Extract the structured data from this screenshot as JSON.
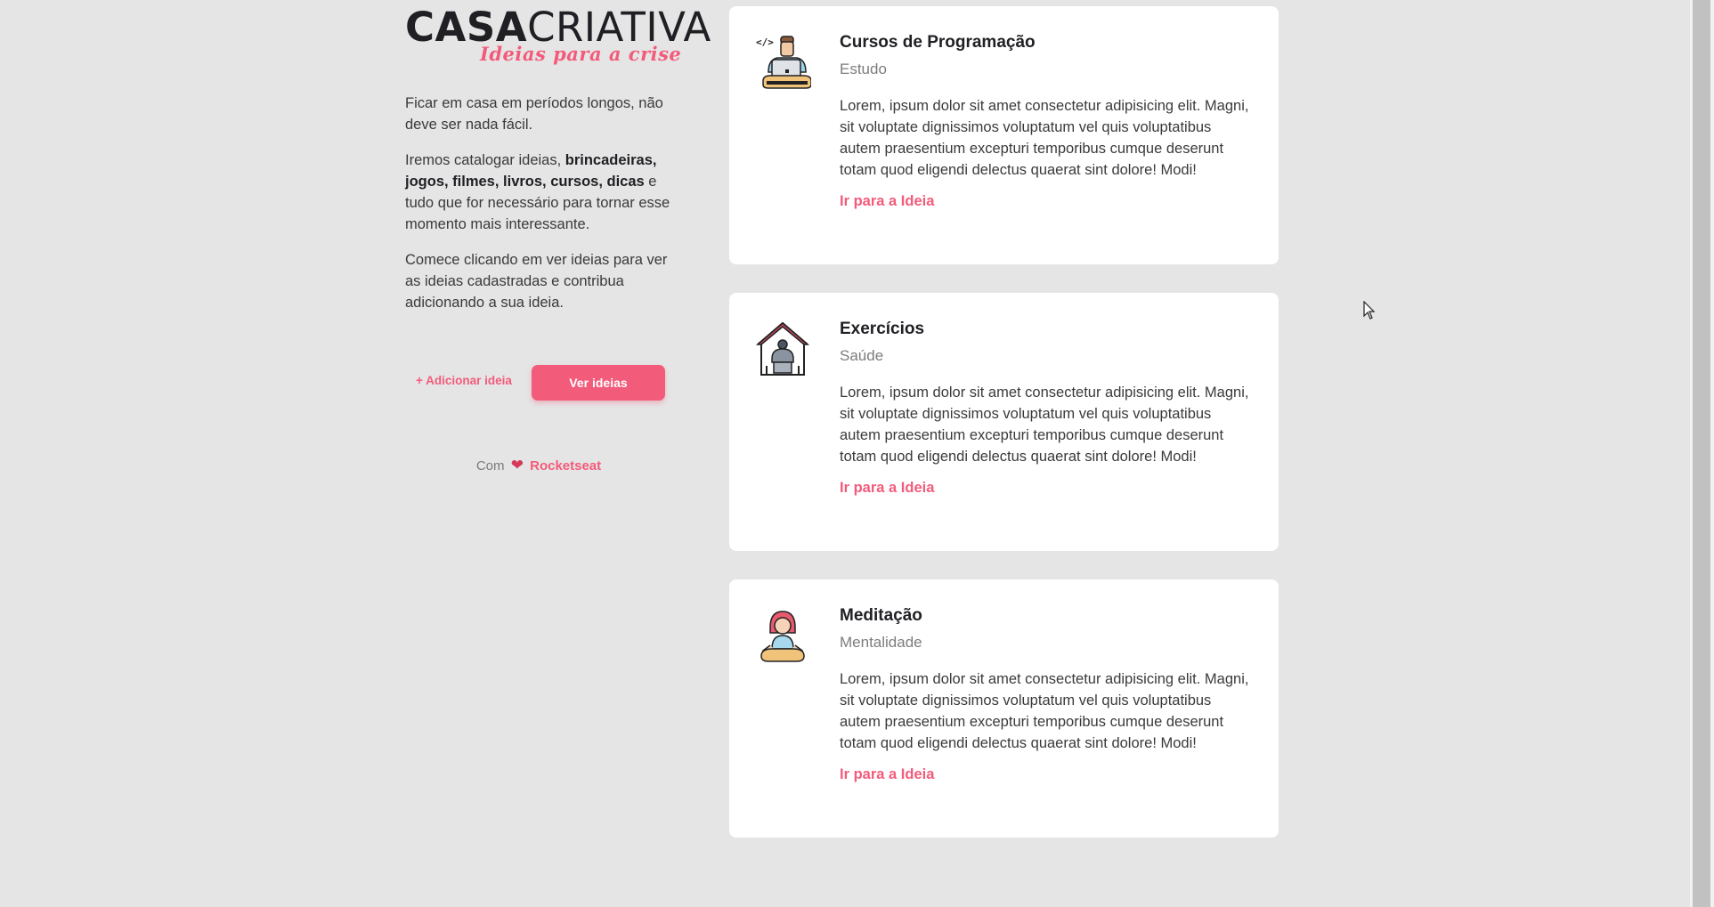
{
  "brand": {
    "part1": "CASA",
    "part2": "CRIATIVA",
    "tagline": "Ideias para a crise"
  },
  "intro": {
    "p1": "Ficar em casa em períodos longos, não deve ser nada fácil.",
    "p2_start": "Iremos catalogar ideias,",
    "p2_bold": "brincadeiras, jogos, filmes, livros, cursos, dicas",
    "p2_end": "e tudo que for necessário para tornar esse momento mais interessante.",
    "p3": "Comece clicando em ver ideias para ver as ideias cadastradas e contribua adicionando a sua ideia."
  },
  "buttons": {
    "add": "+ Adicionar ideia",
    "view": "Ver ideias"
  },
  "credit": {
    "prefix": "Com",
    "heart": "❤",
    "name": "Rocketseat"
  },
  "ideas": [
    {
      "title": "Cursos de Programação",
      "category": "Estudo",
      "icon": "programmer-icon",
      "description": "Lorem, ipsum dolor sit amet consectetur adipisicing elit. Magni, sit voluptate dignissimos voluptatum vel quis voluptatibus autem praesentium excepturi temporibus cumque deserunt totam quod eligendi delectus quaerat sint dolore! Modi!",
      "link": "Ir para a Ideia"
    },
    {
      "title": "Exercícios",
      "category": "Saúde",
      "icon": "home-exercise-icon",
      "description": "Lorem, ipsum dolor sit amet consectetur adipisicing elit. Magni, sit voluptate dignissimos voluptatum vel quis voluptatibus autem praesentium excepturi temporibus cumque deserunt totam quod eligendi delectus quaerat sint dolore! Modi!",
      "link": "Ir para a Ideia"
    },
    {
      "title": "Meditação",
      "category": "Mentalidade",
      "icon": "meditation-icon",
      "description": "Lorem, ipsum dolor sit amet consectetur adipisicing elit. Magni, sit voluptate dignissimos voluptatum vel quis voluptatibus autem praesentium excepturi temporibus cumque deserunt totam quod eligendi delectus quaerat sint dolore! Modi!",
      "link": "Ir para a Ideia"
    }
  ],
  "colors": {
    "accent": "#f35b7b",
    "background": "#e5e5e5",
    "card": "#ffffff",
    "heading": "#1f1f24"
  }
}
